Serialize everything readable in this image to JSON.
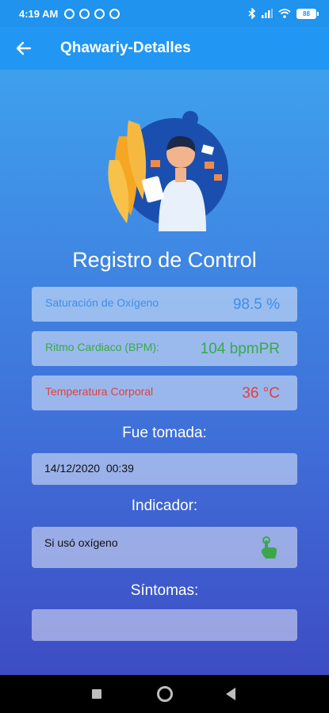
{
  "status_bar": {
    "time": "4:19 AM",
    "battery": "88"
  },
  "app_bar": {
    "title": "Qhawariy-Detalles"
  },
  "main": {
    "title": "Registro de Control",
    "saturation": {
      "label": "Saturación de Oxígeno",
      "value": "98.5 %",
      "color": "#3d8fe8"
    },
    "heart_rate": {
      "label": "Ritmo Cardiaco (BPM):",
      "value": "104 bpmPR",
      "color": "#3aa84a"
    },
    "temperature": {
      "label": "Temperatura Corporal",
      "value": "36 °C",
      "color": "#e2403e"
    },
    "taken_label": "Fue tomada:",
    "taken_value": "14/12/2020  00:39",
    "indicator_label": "Indicador:",
    "indicator_value": "Si usó oxígeno",
    "symptoms_label": "Síntomas:",
    "symptoms_value": ""
  }
}
